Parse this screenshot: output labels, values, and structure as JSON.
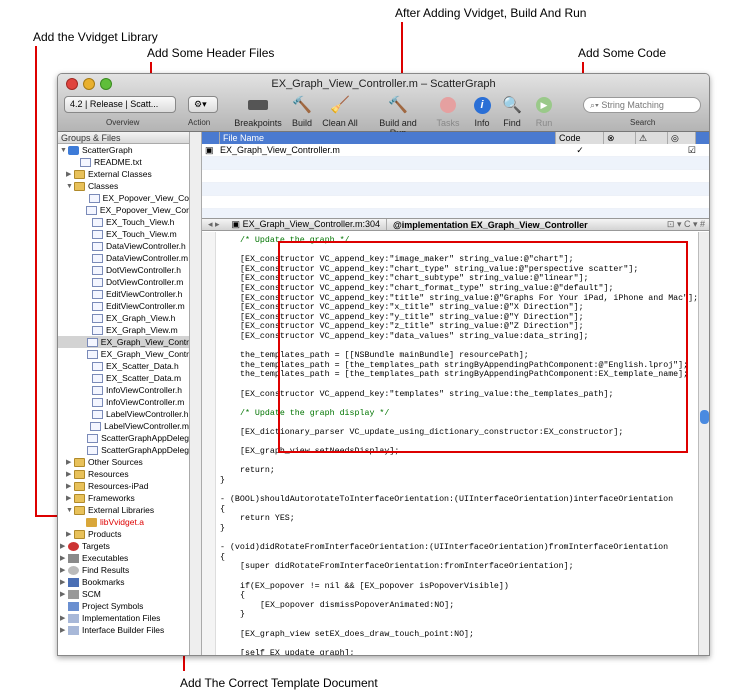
{
  "annotations": {
    "build_run": "After Adding Vvidget, Build And Run",
    "add_library": "Add the Vvidget Library",
    "add_headers": "Add Some Header Files",
    "add_code": "Add Some Code",
    "add_template": "Add The Correct Template Document"
  },
  "window": {
    "title": "EX_Graph_View_Controller.m – ScatterGraph",
    "sdk_popup": "4.2 | Release | Scatt...",
    "overview_label": "Overview",
    "action_label": "Action",
    "tools": [
      "Breakpoints",
      "Build",
      "Clean All",
      "Build and Run",
      "Tasks",
      "Info",
      "Find",
      "Run"
    ],
    "search_placeholder": "String Matching",
    "search_label": "Search"
  },
  "sidebar": {
    "header": "Groups & Files",
    "items": [
      "ScatterGraph",
      "README.txt",
      "External Classes",
      "Classes",
      "EX_Popover_View_Co",
      "EX_Popover_View_Cor",
      "EX_Touch_View.h",
      "EX_Touch_View.m",
      "DataViewController.h",
      "DataViewController.m",
      "DotViewController.h",
      "DotViewController.m",
      "EditViewController.h",
      "EditViewController.m",
      "EX_Graph_View.h",
      "EX_Graph_View.m",
      "EX_Graph_View_Contr",
      "EX_Graph_View_Contr",
      "EX_Scatter_Data.h",
      "EX_Scatter_Data.m",
      "InfoViewController.h",
      "InfoViewController.m",
      "LabelViewController.h",
      "LabelViewController.m",
      "ScatterGraphAppDeleg",
      "ScatterGraphAppDeleg",
      "Other Sources",
      "Resources",
      "Resources-iPad",
      "Frameworks",
      "External Libraries",
      "libVvidget.a",
      "Products",
      "Targets",
      "Executables",
      "Find Results",
      "Bookmarks",
      "SCM",
      "Project Symbols",
      "Implementation Files",
      "Interface Builder Files"
    ]
  },
  "filetable": {
    "col_name": "File Name",
    "col_code": "Code",
    "row_file": "EX_Graph_View_Controller.m"
  },
  "editor": {
    "file_popup": "EX_Graph_View_Controller.m:304",
    "symbol_popup": "@implementation EX_Graph_View_Controller"
  },
  "code_lines": [
    "/* Update the graph */",
    "",
    "[EX_constructor VC_append_key:\"image_maker\" string_value:@\"chart\"];",
    "[EX_constructor VC_append_key:\"chart_type\" string_value:@\"perspective scatter\"];",
    "[EX_constructor VC_append_key:\"chart_subtype\" string_value:@\"linear\"];",
    "[EX_constructor VC_append_key:\"chart_format_type\" string_value:@\"default\"];",
    "[EX_constructor VC_append_key:\"title\" string_value:@\"Graphs For Your iPad, iPhone and Mac\"];",
    "[EX_constructor VC_append_key:\"x_title\" string_value:@\"X Direction\"];",
    "[EX_constructor VC_append_key:\"y_title\" string_value:@\"Y Direction\"];",
    "[EX_constructor VC_append_key:\"z_title\" string_value:@\"Z Direction\"];",
    "[EX_constructor VC_append_key:\"data_values\" string_value:data_string];",
    "",
    "the_templates_path = [[NSBundle mainBundle] resourcePath];",
    "the_templates_path = [the_templates_path stringByAppendingPathComponent:@\"English.lproj\"];",
    "the_templates_path = [the_templates_path stringByAppendingPathComponent:EX_template_name];",
    "",
    "[EX_constructor VC_append_key:\"templates\" string_value:the_templates_path];",
    "",
    "/* Update the graph display */",
    "",
    "[EX_dictionary_parser VC_update_using_dictionary_constructor:EX_constructor];",
    "",
    "[EX_graph_view setNeedsDisplay];",
    "",
    "return;",
    "}",
    "",
    "- (BOOL)shouldAutorotateToInterfaceOrientation:(UIInterfaceOrientation)interfaceOrientation",
    "{",
    "return YES;",
    "}",
    "",
    "- (void)didRotateFromInterfaceOrientation:(UIInterfaceOrientation)fromInterfaceOrientation",
    "{",
    "[super didRotateFromInterfaceOrientation:fromInterfaceOrientation];",
    "",
    "if(EX_popover != nil && [EX_popover isPopoverVisible])",
    "{",
    "[EX_popover dismissPopoverAnimated:NO];",
    "}",
    "",
    "[EX_graph_view setEX_does_draw_touch_point:NO];",
    "",
    "[self EX_update_graph];"
  ]
}
